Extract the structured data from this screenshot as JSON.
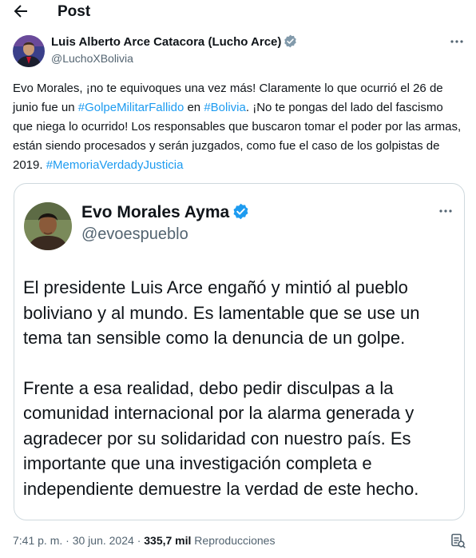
{
  "header": {
    "title": "Post",
    "back_icon": "arrow-left-icon"
  },
  "post": {
    "author_name": "Luis Alberto Arce Catacora (Lucho Arce)",
    "author_handle": "@LuchoXBolivia",
    "text": {
      "p1": "Evo Morales, ¡no te equivoques una vez más! Claramente lo que ocurrió el 26 de junio fue un ",
      "tag1": "#GolpeMilitarFallido",
      "p2": " en ",
      "tag2": "#Bolivia",
      "p3": ". ¡No te pongas del lado del fascismo que niega lo ocurrido! Los responsables que buscaron tomar el poder por las armas, están siendo procesados y serán juzgados, como fue el caso de los golpistas de 2019. ",
      "tag3": "#MemoriaVerdadyJusticia"
    },
    "time": "7:41 p. m.",
    "separator": "·",
    "date": "30 jun. 2024",
    "views_count": "335,7 mil",
    "views_label": "Reproducciones"
  },
  "quoted": {
    "author_name": "Evo Morales Ayma",
    "author_handle": "@evoespueblo",
    "paragraph1": "El presidente Luis Arce engañó y mintió al pueblo boliviano y al mundo. Es lamentable que se use un tema tan sensible como la denuncia de un golpe.",
    "paragraph2": "Frente a esa realidad, debo pedir disculpas a la comunidad internacional por la alarma generada y agradecer por su solidaridad con nuestro país. Es importante que una investigación completa e independiente demuestre la verdad de este hecho."
  },
  "colors": {
    "accent": "#1d9bf0",
    "text": "#0f1419",
    "muted": "#536471",
    "border": "#cfd9de"
  }
}
